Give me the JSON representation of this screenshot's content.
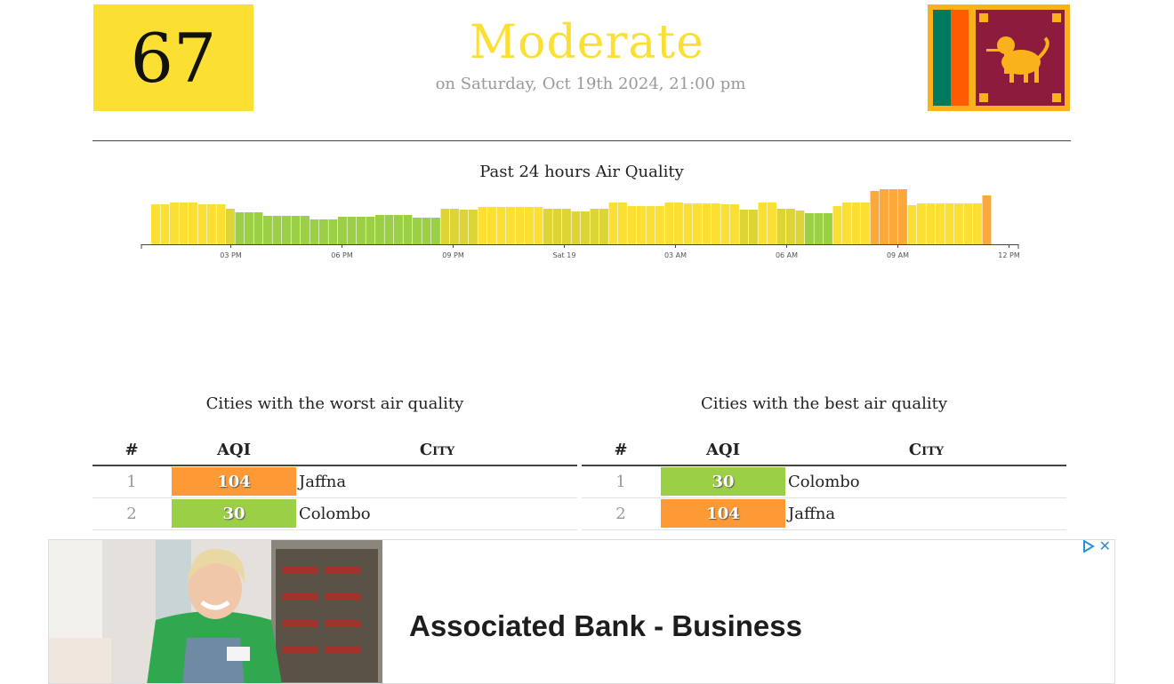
{
  "header": {
    "aqi_value": "67",
    "status": "Moderate",
    "date": "on Saturday, Oct 19th 2024, 21:00 pm",
    "status_color": "#fbe033",
    "flag_icon": "sri-lanka-flag-icon"
  },
  "chart_data": {
    "type": "bar",
    "title": "Past 24 hours Air Quality",
    "tick_labels": [
      "03 PM",
      "06 PM",
      "09 PM",
      "Sat 19",
      "03 AM",
      "06 AM",
      "09 AM",
      "12 PM"
    ],
    "values": [
      45,
      45,
      47,
      47,
      47,
      45,
      45,
      45,
      40,
      36,
      36,
      36,
      32,
      32,
      32,
      32,
      32,
      28,
      28,
      28,
      31,
      31,
      31,
      31,
      33,
      33,
      33,
      33,
      30,
      30,
      30,
      40,
      40,
      39,
      39,
      42,
      42,
      42,
      42,
      42,
      42,
      42,
      40,
      40,
      40,
      37,
      37,
      40,
      40,
      47,
      47,
      43,
      43,
      43,
      43,
      47,
      47,
      46,
      46,
      46,
      46,
      45,
      45,
      39,
      39,
      47,
      47,
      40,
      40,
      38,
      35,
      35,
      35,
      43,
      47,
      47,
      47,
      60,
      62,
      62,
      62,
      44,
      46,
      46,
      46,
      46,
      46,
      46,
      46,
      55
    ],
    "colors": {
      "moderate": "#fbe033",
      "moderate_low": "#dcd535",
      "good": "#9bcf45",
      "unhealthy_sensitive": "#fda83a"
    },
    "axis_line": "#444444"
  },
  "worst": {
    "title": "Cities with the worst air quality",
    "headers": {
      "num": "#",
      "aqi": "AQI",
      "city": "City"
    },
    "rows": [
      {
        "num": "1",
        "aqi": "104",
        "city": "Jaffna",
        "color": "#fd9a35"
      },
      {
        "num": "2",
        "aqi": "30",
        "city": "Colombo",
        "color": "#9bcf45"
      }
    ]
  },
  "best": {
    "title": "Cities with the best air quality",
    "headers": {
      "num": "#",
      "aqi": "AQI",
      "city": "City"
    },
    "rows": [
      {
        "num": "1",
        "aqi": "30",
        "city": "Colombo",
        "color": "#9bcf45"
      },
      {
        "num": "2",
        "aqi": "104",
        "city": "Jaffna",
        "color": "#fd9a35"
      }
    ]
  },
  "ad": {
    "headline": "Associated Bank - Business",
    "close_glyph": "✕",
    "adchoices_icon": "adchoices-icon"
  }
}
